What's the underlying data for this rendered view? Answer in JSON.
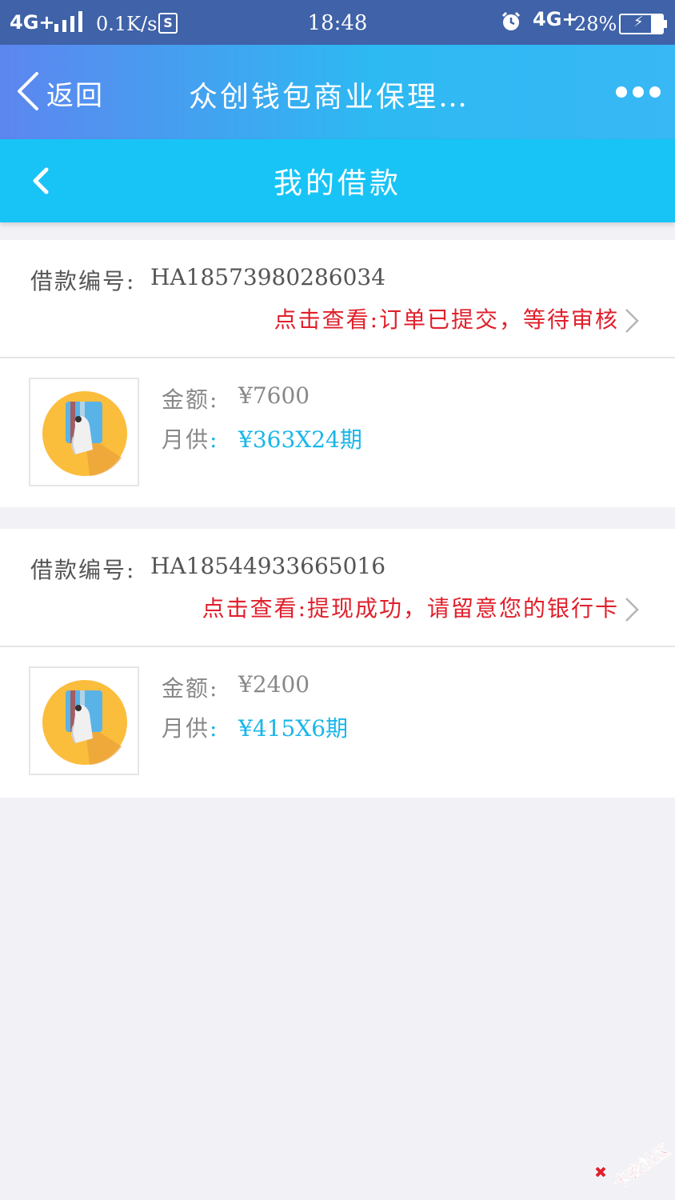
{
  "status_bar": {
    "network": "4G+",
    "speed": "0.1K/s",
    "s_badge": "S",
    "time": "18:48",
    "network2": "4G+",
    "battery": "28%",
    "battery_glyph": "⚡"
  },
  "app_bar": {
    "back_label": "返回",
    "title": "众创钱包商业保理…"
  },
  "page": {
    "title": "我的借款"
  },
  "loans": [
    {
      "number_label": "借款编号:",
      "number": "HA18573980286034",
      "status": "点击查看:订单已提交，等待审核",
      "amount_label": "金额:",
      "amount": "¥7600",
      "monthly_label": "月供",
      "monthly_colon": ":",
      "monthly": "¥363X24期"
    },
    {
      "number_label": "借款编号:",
      "number": "HA18544933665016",
      "status": "点击查看:提现成功，请留意您的银行卡",
      "amount_label": "金额:",
      "amount": "¥2400",
      "monthly_label": "月供",
      "monthly_colon": ":",
      "monthly": "¥415X6期"
    }
  ],
  "watermark": "卡农社区",
  "colors": {
    "status_bar": "#3f62a8",
    "page_bar": "#18c4f6",
    "status_red": "#e0202c",
    "monthly_blue": "#19b6e9",
    "icon_circle": "#fbbd3c"
  }
}
